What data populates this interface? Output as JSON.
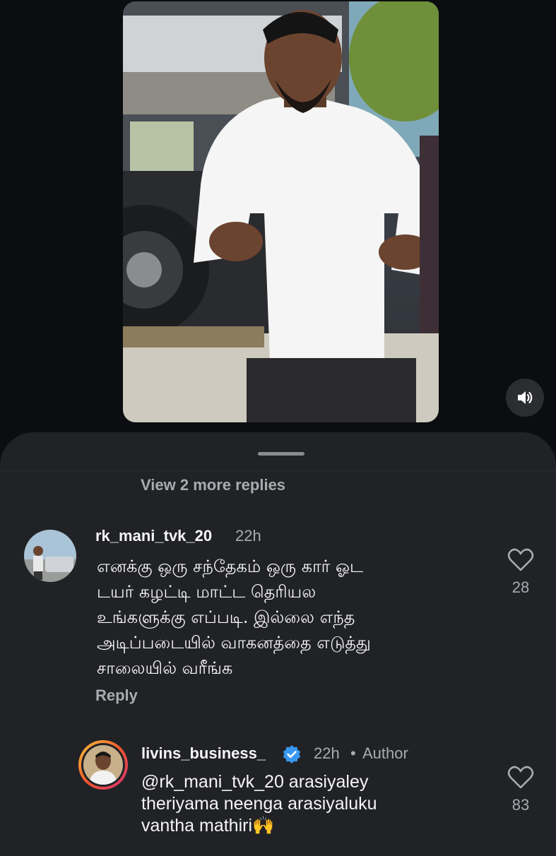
{
  "view_more": "View 2 more replies",
  "comments": [
    {
      "username": "rk_mani_tvk_20",
      "time": "22h",
      "text": "எனக்கு ஒரு சந்தேகம் ஒரு கார் ஓட\nடயர் கழட்டி மாட்ட தெரியல\nஉங்களுக்கு எப்படி. இல்லை எந்த\nஅடிப்படையில் வாகனத்தை எடுத்து\nசாலையில் வரீங்க",
      "likes": "28",
      "reply_label": "Reply"
    },
    {
      "username": "livins_business_",
      "verified": true,
      "time": "22h",
      "author_label": "Author",
      "separator": "•",
      "text": "@rk_mani_tvk_20 arasiyaley\ntheriyama neenga arasiyaluku\nvantha mathiri🙌",
      "likes": "83"
    }
  ],
  "icons": {
    "mute": "volume-icon",
    "like": "heart-outline-icon",
    "verified": "verified-badge-icon"
  },
  "colors": {
    "sheet_bg": "#212226",
    "verified_blue": "#3897f0",
    "story_ring": "#f1582a"
  }
}
